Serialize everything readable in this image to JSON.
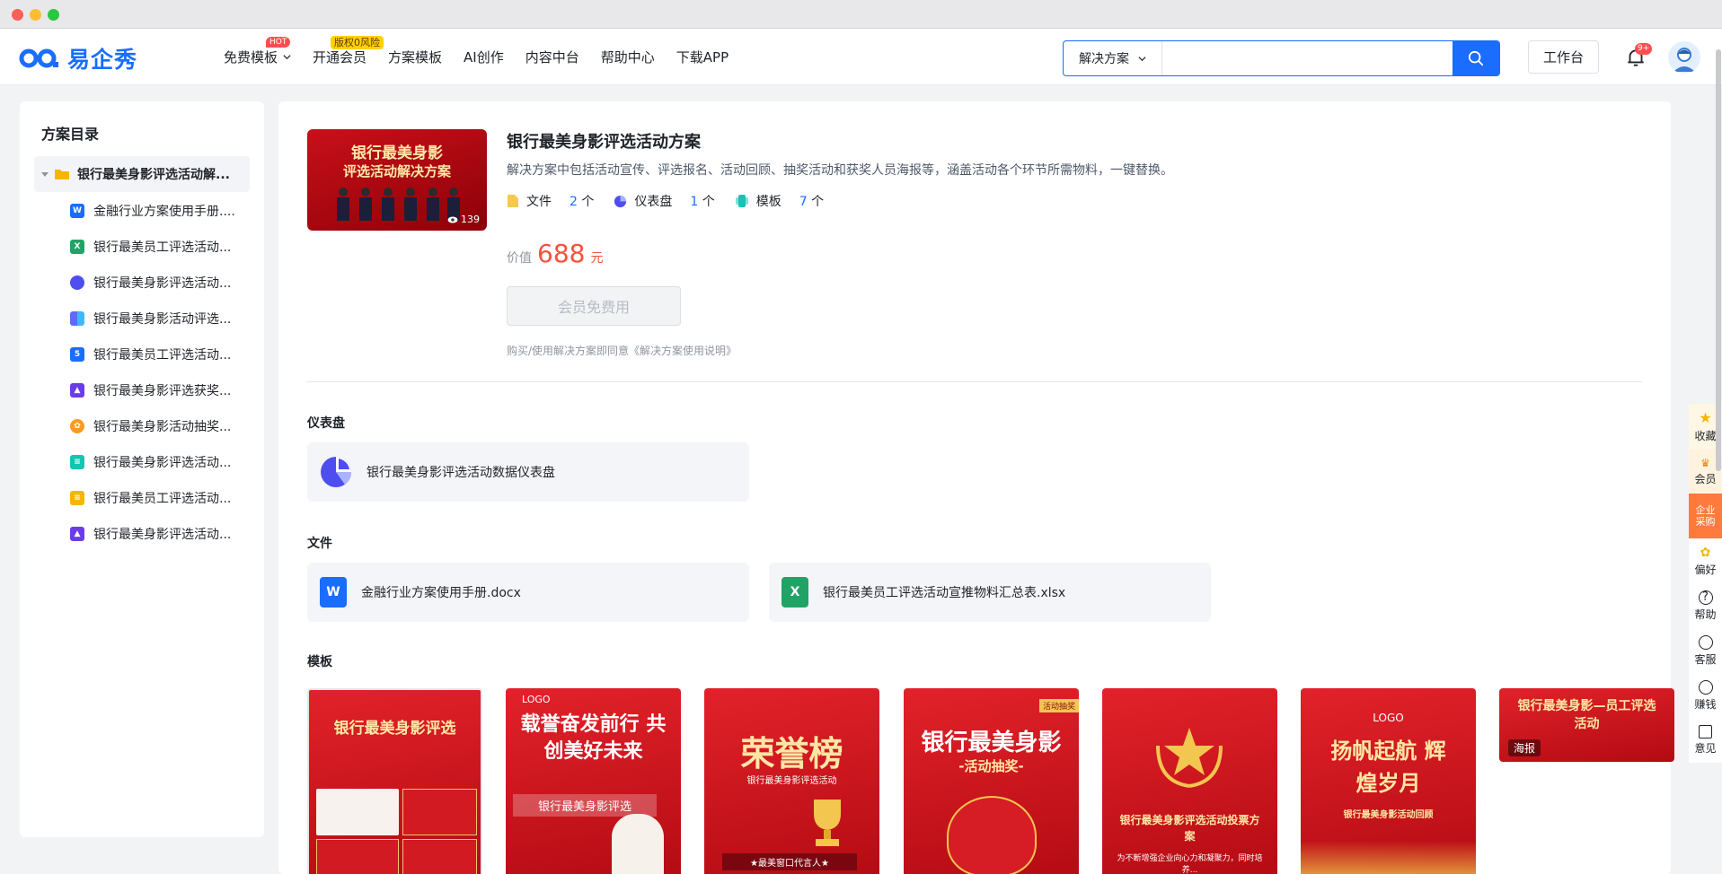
{
  "header": {
    "logo_text": "易企秀",
    "nav": [
      {
        "label": "免费模板",
        "badge": "HOT"
      },
      {
        "label": "开通会员",
        "badge": "版权0风险"
      },
      {
        "label": "方案模板"
      },
      {
        "label": "AI创作"
      },
      {
        "label": "内容中台"
      },
      {
        "label": "帮助中心"
      },
      {
        "label": "下载APP"
      }
    ],
    "search": {
      "select_value": "解决方案",
      "placeholder": ""
    },
    "workbench_label": "工作台",
    "bell_badge": "9+"
  },
  "sidebar": {
    "title": "方案目录",
    "root": "银行最美身影评选活动解...",
    "items": [
      {
        "label": "金融行业方案使用手册....",
        "icon": "word-icon",
        "color": "#1a6dff"
      },
      {
        "label": "银行最美员工评选活动...",
        "icon": "excel-icon",
        "color": "#21a366"
      },
      {
        "label": "银行最美身影评选活动...",
        "icon": "dashboard-icon",
        "color": "#4e4ef0"
      },
      {
        "label": "银行最美身影活动评选...",
        "icon": "book-icon",
        "color": "#5b6cf8"
      },
      {
        "label": "银行最美员工评选活动...",
        "icon": "h5-icon",
        "color": "#1a6dff"
      },
      {
        "label": "银行最美身影评选获奖...",
        "icon": "image-icon",
        "color": "#6a3de8"
      },
      {
        "label": "银行最美身影活动抽奖...",
        "icon": "lottery-icon",
        "color": "#ff9a1f"
      },
      {
        "label": "银行最美身影评选活动...",
        "icon": "form-icon",
        "color": "#17c3b2"
      },
      {
        "label": "银行最美员工评选活动...",
        "icon": "doc-icon",
        "color": "#f7b500"
      },
      {
        "label": "银行最美身影评选活动...",
        "icon": "image-icon",
        "color": "#6a3de8"
      }
    ]
  },
  "solution": {
    "cover_title_1": "银行最美身影",
    "cover_title_2": "评选活动解决方案",
    "cover_views": "139",
    "title": "银行最美身影评选活动方案",
    "description": "解决方案中包括活动宣传、评选报名、活动回顾、抽奖活动和获奖人员海报等，涵盖活动各个环节所需物料，一键替换。",
    "stats": [
      {
        "label": "文件",
        "count": "2",
        "unit": "个"
      },
      {
        "label": "仪表盘",
        "count": "1",
        "unit": "个"
      },
      {
        "label": "模板",
        "count": "7",
        "unit": "个"
      }
    ],
    "price_label": "价值",
    "price_value": "688",
    "price_unit": "元",
    "member_button": "会员免费用",
    "agreement": "购买/使用解决方案即同意《解决方案使用说明》"
  },
  "dashboard_section": {
    "title": "仪表盘",
    "items": [
      {
        "label": "银行最美身影评选活动数据仪表盘"
      }
    ]
  },
  "file_section": {
    "title": "文件",
    "items": [
      {
        "label": "金融行业方案使用手册.docx",
        "icon_text": "W"
      },
      {
        "label": "银行最美员工评选活动宣推物料汇总表.xlsx",
        "icon_text": "X"
      }
    ]
  },
  "template_section": {
    "title": "模板",
    "items": [
      {
        "title": "银行最美身影评选",
        "subtitle": ""
      },
      {
        "title": "载誉奋发前行 共创美好未来",
        "subtitle": "银行最美身影评选",
        "logo": "LOGO"
      },
      {
        "title": "荣誉榜",
        "subtitle": "银行最美身影评选活动",
        "tag": "★最美窗口代言人★"
      },
      {
        "title": "银行最美身影",
        "subtitle": "-活动抽奖-",
        "tag": "活动抽奖"
      },
      {
        "title": "银行最美身影评选活动投票方案",
        "subtitle": "为不断增强企业向心力和凝聚力，同时培养..."
      },
      {
        "title": "扬帆起航 辉煌岁月",
        "subtitle": "银行最美身影活动回顾",
        "logo": "LOGO"
      },
      {
        "title": "银行最美身影—员工评选活动",
        "subtitle": "",
        "tag": "海报"
      }
    ]
  },
  "rail": [
    {
      "label": "收藏"
    },
    {
      "label": "会员"
    },
    {
      "label": "企业采购"
    },
    {
      "label": "偏好"
    },
    {
      "label": "帮助"
    },
    {
      "label": "客服"
    },
    {
      "label": "赚钱"
    },
    {
      "label": "意见"
    }
  ],
  "colors": {
    "accent": "#1a6dff",
    "price": "#f5513d",
    "brand_red": "#c8101a"
  }
}
